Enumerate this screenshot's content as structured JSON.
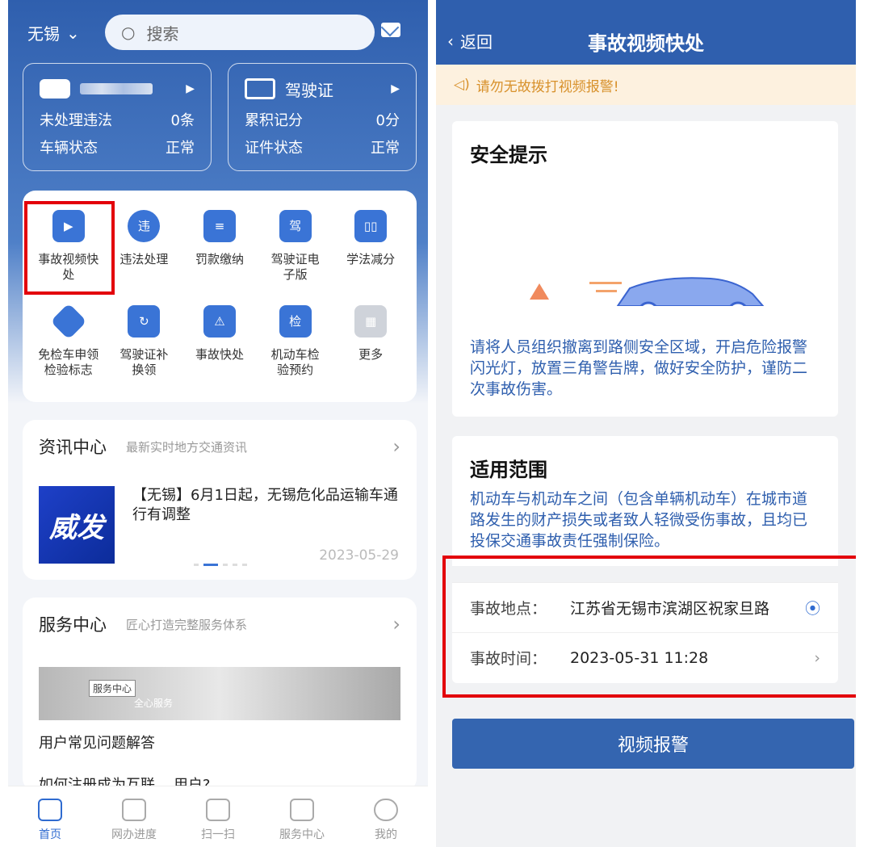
{
  "left": {
    "city": "无锡",
    "search_placeholder": "搜索",
    "vehicle_card": {
      "rows": [
        {
          "label": "未处理违法",
          "value": "0条"
        },
        {
          "label": "车辆状态",
          "value": "正常"
        }
      ]
    },
    "license_card": {
      "title": "驾驶证",
      "rows": [
        {
          "label": "累积记分",
          "value": "0分"
        },
        {
          "label": "证件状态",
          "value": "正常"
        }
      ]
    },
    "grid": [
      {
        "label": "事故视频快处",
        "icon": "siren-video-icon"
      },
      {
        "label": "违法处理",
        "icon": "violation-search-icon"
      },
      {
        "label": "罚款缴纳",
        "icon": "fine-bill-icon"
      },
      {
        "label": "驾驶证电子版",
        "icon": "e-license-icon"
      },
      {
        "label": "学法减分",
        "icon": "book-icon"
      },
      {
        "label": "免检车申领检验标志",
        "icon": "exempt-badge-icon"
      },
      {
        "label": "驾驶证补换领",
        "icon": "license-renew-icon"
      },
      {
        "label": "事故快处",
        "icon": "car-accident-icon"
      },
      {
        "label": "机动车检验预约",
        "icon": "car-inspect-icon"
      },
      {
        "label": "更多",
        "icon": "more-grid-icon"
      }
    ],
    "news": {
      "title": "资讯中心",
      "subtitle": "最新实时地方交通资讯",
      "image_text": "威发",
      "headline": "【无锡】6月1日起，无锡危化品运输车通行有调整",
      "date": "2023-05-29"
    },
    "service": {
      "title": "服务中心",
      "subtitle": "匠心打造完整服务体系",
      "banner_tag": "服务中心",
      "banner_caption": "全心服务",
      "faq1": "用户常见问题解答",
      "faq2": "如何注册成为互联",
      "faq2_tail": "用户?"
    },
    "tabs": [
      {
        "label": "首页",
        "icon": "home-icon"
      },
      {
        "label": "网办进度",
        "icon": "monitor-icon"
      },
      {
        "label": "扫一扫",
        "icon": "scan-icon"
      },
      {
        "label": "服务中心",
        "icon": "handshake-icon"
      },
      {
        "label": "我的",
        "icon": "user-icon"
      }
    ]
  },
  "right": {
    "back": "返回",
    "title": "事故视频快处",
    "notice": "请勿无故拨打视频报警!",
    "safety": {
      "title": "安全提示",
      "text": "请将人员组织撤离到路侧安全区域，开启危险报警闪光灯，放置三角警告牌，做好安全防护，谨防二次事故伤害。"
    },
    "scope": {
      "title": "适用范围",
      "text": "机动车与机动车之间（包含单辆机动车）在城市道路发生的财产损失或者致人轻微受伤事故，且均已投保交通事故责任强制保险。"
    },
    "location": {
      "label": "事故地点：",
      "value": "江苏省无锡市滨湖区祝家旦路"
    },
    "time": {
      "label": "事故时间：",
      "value": "2023-05-31 11:28"
    },
    "button": "视频报警"
  }
}
